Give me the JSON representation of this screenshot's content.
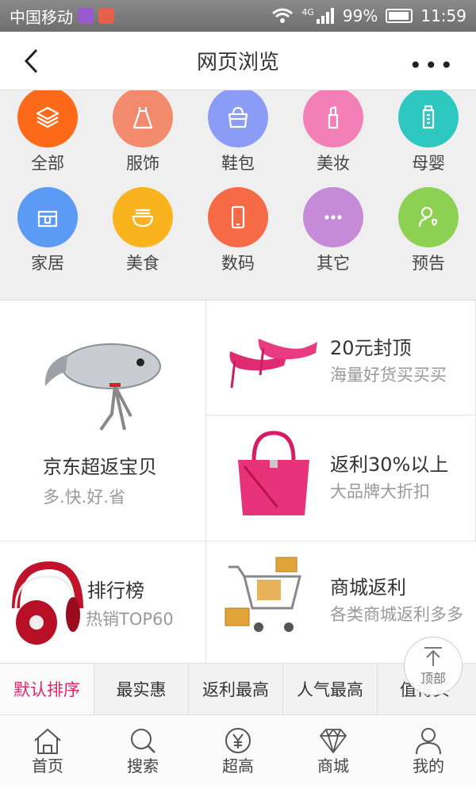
{
  "status_bar": {
    "carrier": "中国移动",
    "network": "4G",
    "battery": "99%",
    "time": "11:59"
  },
  "header": {
    "title": "网页浏览",
    "more": "•••"
  },
  "categories": [
    {
      "label": "全部",
      "color": "#ff6a1a",
      "icon": "layers-icon"
    },
    {
      "label": "服饰",
      "color": "#f28a6e",
      "icon": "dress-icon"
    },
    {
      "label": "鞋包",
      "color": "#8a9cf5",
      "icon": "bag-icon"
    },
    {
      "label": "美妆",
      "color": "#f27fb6",
      "icon": "lipstick-icon"
    },
    {
      "label": "母婴",
      "color": "#2ec7c0",
      "icon": "baby-bottle-icon"
    },
    {
      "label": "家居",
      "color": "#5b9af5",
      "icon": "home-box-icon"
    },
    {
      "label": "美食",
      "color": "#f9b31c",
      "icon": "noodle-bowl-icon"
    },
    {
      "label": "数码",
      "color": "#f66a45",
      "icon": "phone-icon"
    },
    {
      "label": "其它",
      "color": "#c58ad8",
      "icon": "more-dots-icon"
    },
    {
      "label": "预告",
      "color": "#8cd152",
      "icon": "person-heart-icon"
    }
  ],
  "promos": {
    "jd": {
      "title": "京东超返宝贝",
      "subtitle": "多.快.好.省"
    },
    "top_price": {
      "title": "20元封顶",
      "subtitle": "海量好货买买买"
    },
    "rebate30": {
      "title": "返利30%以上",
      "subtitle": "大品牌大折扣"
    },
    "ranking": {
      "title": "排行榜",
      "subtitle": "热销TOP60"
    },
    "mall": {
      "title": "商城返利",
      "subtitle": "各类商城返利多多"
    }
  },
  "sort_tabs": [
    {
      "label": "默认排序",
      "active": true
    },
    {
      "label": "最实惠",
      "active": false
    },
    {
      "label": "返利最高",
      "active": false
    },
    {
      "label": "人气最高",
      "active": false
    },
    {
      "label": "值得买",
      "active": false
    }
  ],
  "to_top": {
    "label": "顶部"
  },
  "tabbar": [
    {
      "label": "首页",
      "icon": "home-icon"
    },
    {
      "label": "搜索",
      "icon": "search-icon"
    },
    {
      "label": "超高",
      "icon": "yen-coin-icon"
    },
    {
      "label": "商城",
      "icon": "diamond-icon"
    },
    {
      "label": "我的",
      "icon": "user-icon"
    }
  ],
  "colors": {
    "accent": "#e22466",
    "status_bar": "#7a7a7a"
  }
}
